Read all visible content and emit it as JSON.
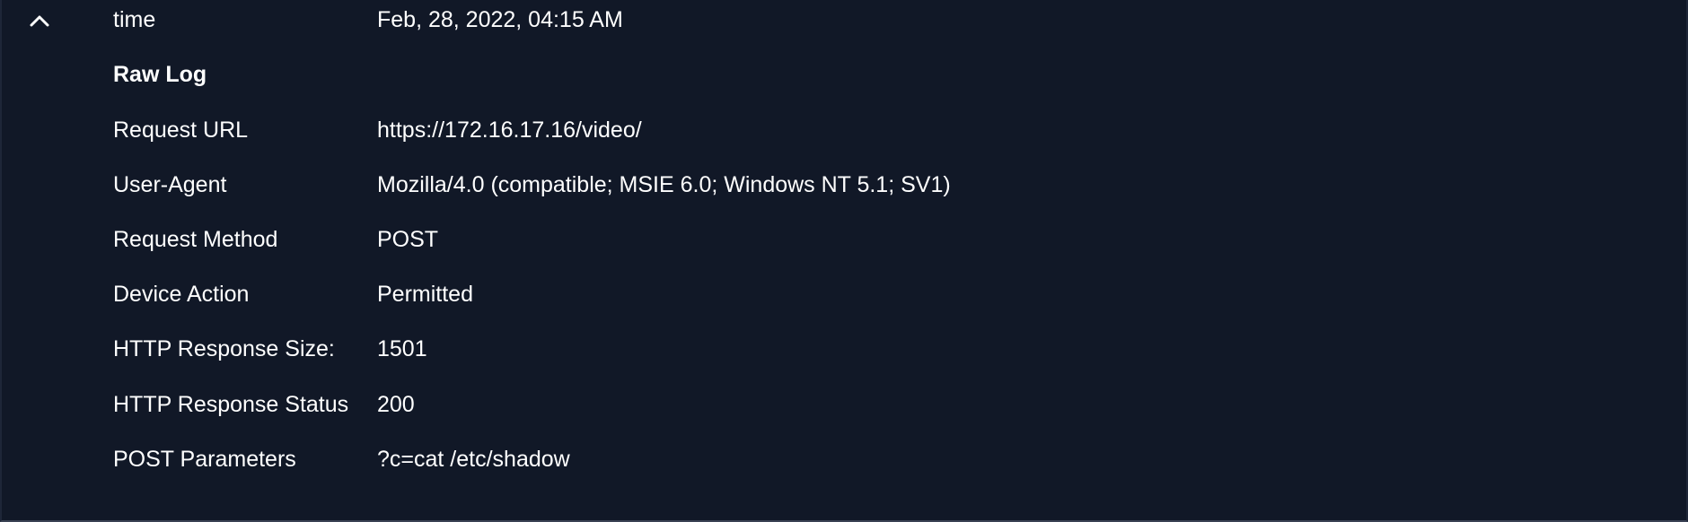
{
  "header": {
    "label": "time",
    "value": "Feb, 28, 2022, 04:15 AM",
    "toggle_icon": "chevron-up-icon"
  },
  "raw_log": {
    "title": "Raw Log",
    "fields": [
      {
        "label": "Request URL",
        "value": "https://172.16.17.16/video/"
      },
      {
        "label": "User-Agent",
        "value": "Mozilla/4.0 (compatible; MSIE 6.0; Windows NT 5.1; SV1)"
      },
      {
        "label": "Request Method",
        "value": "POST"
      },
      {
        "label": "Device Action",
        "value": "Permitted"
      },
      {
        "label": "HTTP Response Size:",
        "value": "1501"
      },
      {
        "label": "HTTP Response Status",
        "value": "200"
      },
      {
        "label": "POST Parameters",
        "value": "?c=cat /etc/shadow"
      }
    ]
  },
  "colors": {
    "background": "#111827",
    "text": "#ffffff"
  }
}
